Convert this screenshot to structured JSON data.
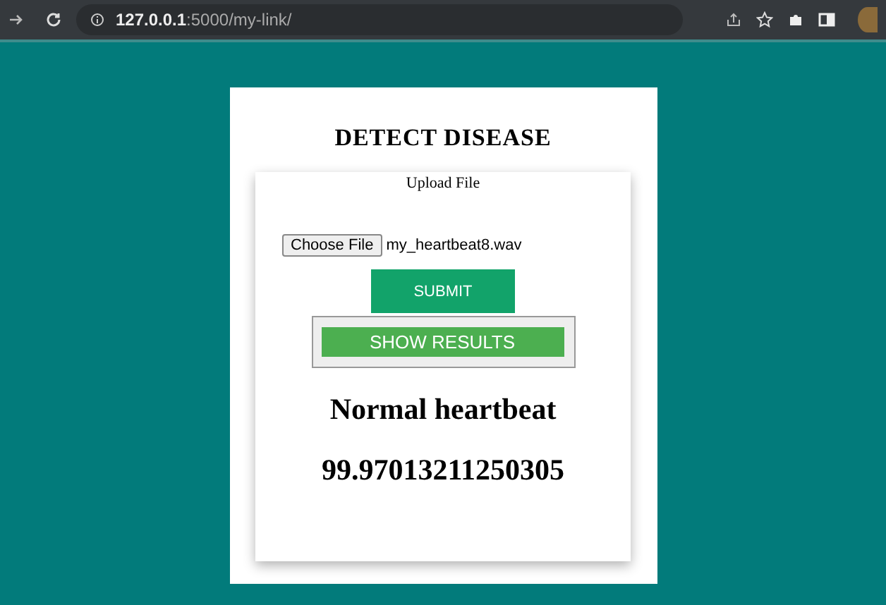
{
  "browser": {
    "address_host": "127.0.0.1",
    "address_path": ":5000/my-link/"
  },
  "page": {
    "title": "DETECT DISEASE",
    "upload_label": "Upload File",
    "choose_file_button": "Choose File",
    "file_name": "my_heartbeat8.wav",
    "submit_button": "SUBMIT",
    "results_button": "SHOW RESULTS",
    "result": "Normal heartbeat",
    "score": "99.97013211250305"
  }
}
